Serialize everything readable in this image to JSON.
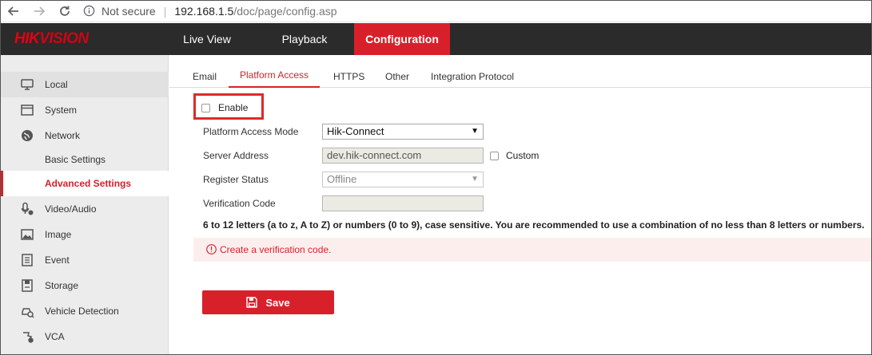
{
  "browser": {
    "security_label": "Not secure",
    "url_host": "192.168.1.5",
    "url_path": "/doc/page/config.asp",
    "icons": [
      "back-arrow-icon",
      "forward-arrow-icon",
      "reload-icon",
      "info-icon"
    ]
  },
  "topnav": {
    "logo_part1": "HIK",
    "logo_part2": "VISION",
    "items": [
      {
        "label": "Live View"
      },
      {
        "label": "Playback"
      },
      {
        "label": "Configuration"
      }
    ],
    "active_index": 2
  },
  "sidebar": {
    "items": [
      {
        "label": "Local",
        "icon": "monitor-icon"
      },
      {
        "label": "System",
        "icon": "window-icon"
      },
      {
        "label": "Network",
        "icon": "globe-icon"
      },
      {
        "label": "Basic Settings"
      },
      {
        "label": "Advanced Settings"
      },
      {
        "label": "Video/Audio",
        "icon": "video-audio-icon"
      },
      {
        "label": "Image",
        "icon": "image-icon"
      },
      {
        "label": "Event",
        "icon": "event-list-icon"
      },
      {
        "label": "Storage",
        "icon": "storage-icon"
      },
      {
        "label": "Vehicle Detection",
        "icon": "vehicle-detection-icon"
      },
      {
        "label": "VCA",
        "icon": "vca-icon"
      }
    ]
  },
  "tabs": {
    "items": [
      {
        "label": "Email"
      },
      {
        "label": "Platform Access"
      },
      {
        "label": "HTTPS"
      },
      {
        "label": "Other"
      },
      {
        "label": "Integration Protocol"
      }
    ],
    "active_index": 1
  },
  "form": {
    "enable_label": "Enable",
    "enable_checked": false,
    "platform_access_mode_label": "Platform Access Mode",
    "platform_access_mode_value": "Hik-Connect",
    "server_address_label": "Server Address",
    "server_address_value": "dev.hik-connect.com",
    "custom_label": "Custom",
    "custom_checked": false,
    "register_status_label": "Register Status",
    "register_status_value": "Offline",
    "verification_code_label": "Verification Code",
    "verification_code_value": "",
    "hint": "6 to 12 letters (a to z, A to Z) or numbers (0 to 9), case sensitive. You are recommended to use a combination of no less than 8 letters or numbers.",
    "error_message": "Create a verification code.",
    "save_label": "Save"
  },
  "colors": {
    "accent": "#d8202b",
    "nav_bg": "#2b2b2b",
    "sidebar_bg": "#ececec",
    "error_bg": "#fdeeee",
    "highlight_box": "#e02828"
  }
}
